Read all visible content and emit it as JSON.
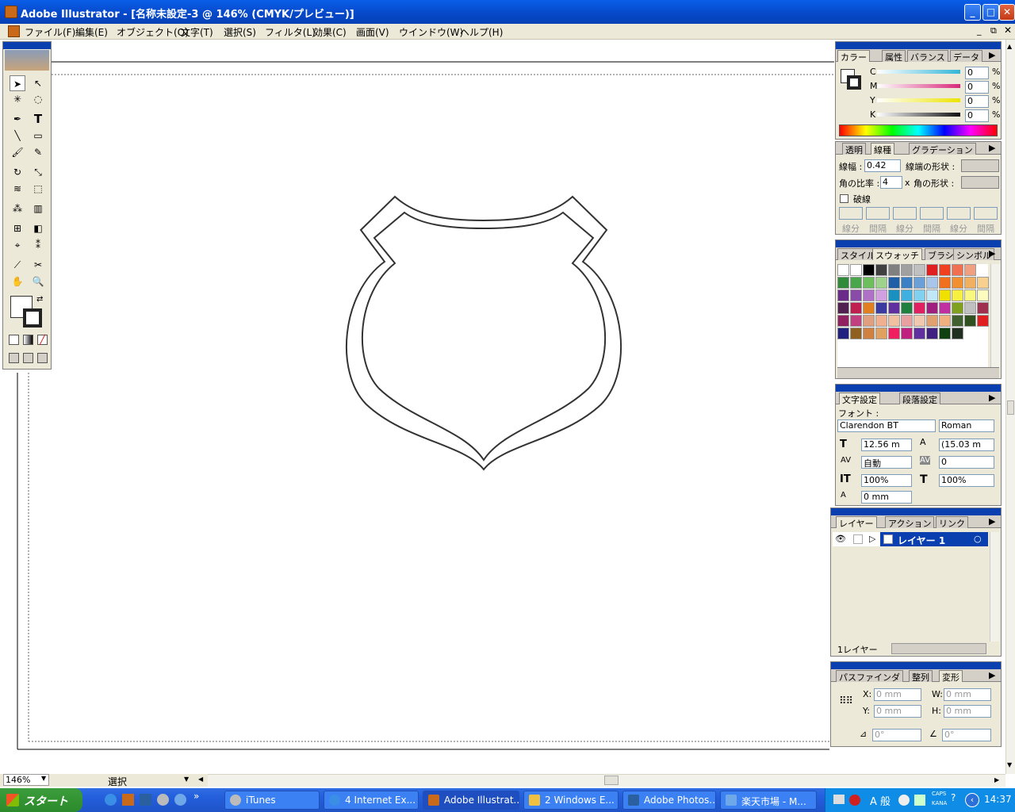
{
  "window": {
    "title": "Adobe Illustrator - [名称未設定-3 @ 146% (CMYK/プレビュー)]"
  },
  "menu": [
    "ファイル(F)",
    "編集(E)",
    "オブジェクト(O)",
    "文字(T)",
    "選択(S)",
    "フィルタ(L)",
    "効果(C)",
    "画面(V)",
    "ウインドウ(W)",
    "ヘルプ(H)"
  ],
  "status": {
    "zoom": "146%",
    "mode": "選択"
  },
  "color_panel": {
    "tabs": [
      "カラー",
      "属性",
      "バランス",
      "データ"
    ],
    "channels": [
      {
        "label": "C",
        "value": "0",
        "unit": "%",
        "color": "#33b6d8"
      },
      {
        "label": "M",
        "value": "0",
        "unit": "%",
        "color": "#d8297a"
      },
      {
        "label": "Y",
        "value": "0",
        "unit": "%",
        "color": "#ede400"
      },
      {
        "label": "K",
        "value": "0",
        "unit": "%",
        "color": "#111111"
      }
    ]
  },
  "stroke_panel": {
    "tabs": [
      "透明",
      "線種",
      "グラデーション"
    ],
    "weight_label": "線幅 :",
    "weight_value": "0.42",
    "cap_label": "線端の形状 :",
    "miter_label": "角の比率 :",
    "miter_value": "4",
    "miter_unit": "x",
    "join_label": "角の形状 :",
    "dashed_label": "破線",
    "dash_labels": [
      "線分",
      "間隔",
      "線分",
      "間隔",
      "線分",
      "間隔"
    ]
  },
  "swatch_panel": {
    "tabs": [
      "スタイル",
      "スウォッチ",
      "ブラシ",
      "シンボル"
    ],
    "rows": [
      [
        "#ffffff",
        "#ffffff",
        "#000000",
        "#404040",
        "#808080",
        "#a0a0a0",
        "#c0c0c0",
        "#e02020",
        "#f04020",
        "#f07050",
        "#f0a080"
      ],
      [
        "#2f8a3a",
        "#4aa64a",
        "#6cbf5c",
        "#9fd28a",
        "#1f5fa8",
        "#3b7fc4",
        "#6a9fd8",
        "#a8c6ea",
        "#f07020",
        "#f09030",
        "#f0b060",
        "#f8d090"
      ],
      [
        "#6a2a8a",
        "#8a4aa8",
        "#b070c8",
        "#d0a0e0",
        "#1a90c0",
        "#40b0e0",
        "#80d0f0",
        "#c0e8f8",
        "#f0e000",
        "#f8f040",
        "#f8f880",
        "#fcfcc0"
      ],
      [
        "#502050",
        "#c02050",
        "#e08020",
        "#3a3aa0",
        "#6030a0",
        "#208040",
        "#e02060",
        "#a02080",
        "#c030a0",
        "#80a020",
        "#c0c0c0",
        "#a03050"
      ],
      [
        "#902060",
        "#c04080",
        "#e0a080",
        "#f0b090",
        "#f0c0a0",
        "#e8a0a0",
        "#f0c8b0",
        "#e0a070",
        "#f0b080",
        "#406030",
        "#305020",
        "#e02020"
      ],
      [
        "#202080",
        "#906020",
        "#d08040",
        "#e0a060",
        "#f02060",
        "#c02080",
        "#6030a0",
        "#402080",
        "#104010",
        "#203020"
      ]
    ]
  },
  "type_panel": {
    "tabs": [
      "文字設定",
      "段落設定"
    ],
    "font_label": "フォント :",
    "font_family": "Clarendon BT",
    "font_style": "Roman",
    "size": "12.56 m",
    "leading": "(15.03 m",
    "kerning": "自動",
    "tracking": "0",
    "vscale": "100%",
    "hscale": "100%",
    "baseline": "0 mm"
  },
  "layers_panel": {
    "tabs": [
      "レイヤー",
      "アクション",
      "リンク"
    ],
    "layers": [
      {
        "name": "レイヤー 1"
      }
    ],
    "count": "1レイヤー"
  },
  "transform_panel": {
    "tabs": [
      "パスファインダ",
      "整列",
      "変形"
    ],
    "x_label": "X:",
    "x": "0 mm",
    "y_label": "Y:",
    "y": "0 mm",
    "w_label": "W:",
    "w": "0 mm",
    "h_label": "H:",
    "h": "0 mm",
    "rotate": "0°",
    "shear": "0°"
  },
  "taskbar": {
    "start": "スタート",
    "buttons": [
      {
        "label": "iTunes",
        "active": false
      },
      {
        "label": "4 Internet Ex...",
        "active": false
      },
      {
        "label": "Adobe Illustrat...",
        "active": true
      },
      {
        "label": "2 Windows E...",
        "active": false
      },
      {
        "label": "Adobe Photos...",
        "active": false
      },
      {
        "label": "楽天市場 - M...",
        "active": false
      }
    ],
    "ime": "A 般",
    "caps": "CAPS",
    "kana": "KANA",
    "clock": "14:37"
  },
  "colors": {
    "titlebar": "#0a5ee8",
    "selection": "#0a3fb0",
    "shield_stroke": "#333333"
  }
}
